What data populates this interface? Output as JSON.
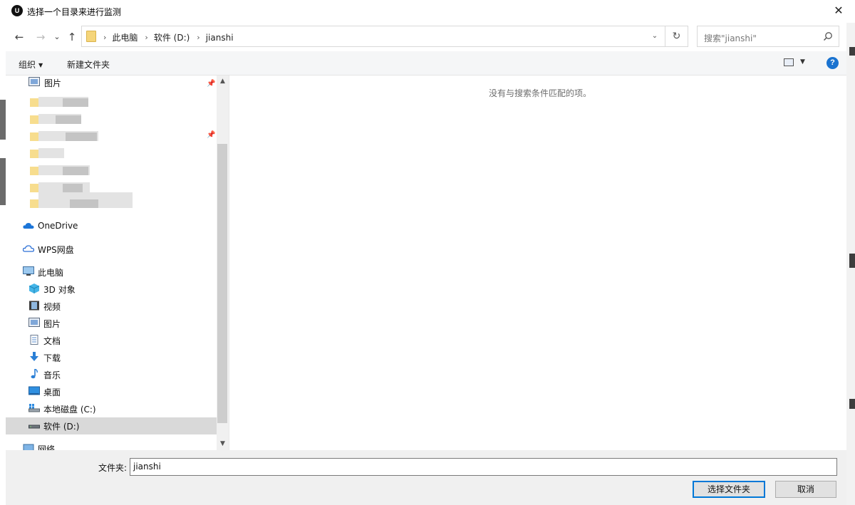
{
  "window": {
    "app_icon_glyph": "U",
    "title": "选择一个目录来进行监测",
    "close_glyph": "✕"
  },
  "nav": {
    "back_glyph": "←",
    "forward_glyph": "→",
    "recent_glyph": "⌄",
    "up_glyph": "↑"
  },
  "address": {
    "crumbs": [
      "此电脑",
      "软件 (D:)",
      "jianshi"
    ],
    "separator": "›",
    "dropdown_glyph": "⌄",
    "refresh_glyph": "↻"
  },
  "search": {
    "placeholder": "搜索\"jianshi\""
  },
  "toolbar": {
    "organize_label": "组织",
    "organize_caret": "▼",
    "new_folder_label": "新建文件夹",
    "view_caret": "▼",
    "help_glyph": "?"
  },
  "sidebar": {
    "top_item": "图片",
    "onedrive": "OneDrive",
    "wps": "WPS网盘",
    "this_pc": "此电脑",
    "items": [
      {
        "label": "3D 对象",
        "icon": "3d-objects-icon"
      },
      {
        "label": "视频",
        "icon": "video-icon"
      },
      {
        "label": "图片",
        "icon": "pictures-icon"
      },
      {
        "label": "文档",
        "icon": "documents-icon"
      },
      {
        "label": "下载",
        "icon": "download-icon"
      },
      {
        "label": "音乐",
        "icon": "music-icon"
      },
      {
        "label": "桌面",
        "icon": "desktop-icon"
      },
      {
        "label": "本地磁盘 (C:)",
        "icon": "drive-c-icon"
      },
      {
        "label": "软件 (D:)",
        "icon": "drive-d-icon"
      }
    ],
    "network": "网络",
    "pin_glyph": "📌",
    "scroll_up": "▲",
    "scroll_down": "▼"
  },
  "content": {
    "empty_message": "没有与搜索条件匹配的项。"
  },
  "footer": {
    "folder_label": "文件夹:",
    "folder_value": "jianshi",
    "select_button": "选择文件夹",
    "cancel_button": "取消"
  }
}
